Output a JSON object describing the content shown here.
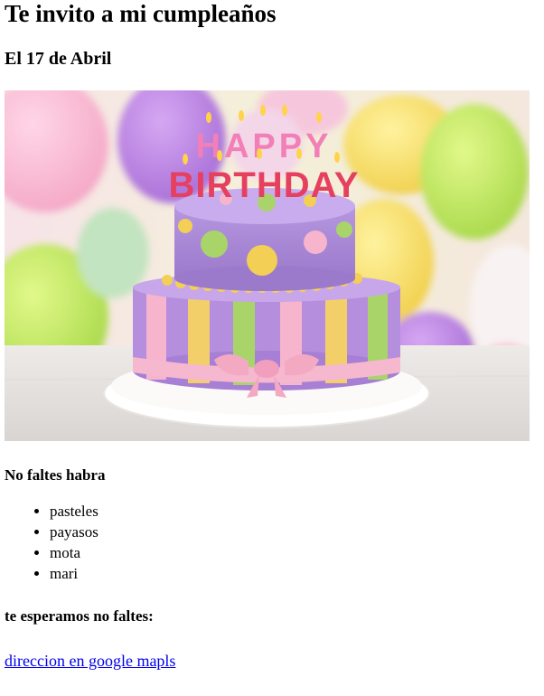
{
  "invitation": {
    "title": "Te invito a mi cumpleaños",
    "date": "El 17 de Abril",
    "image_alt": "Pastel de cumpleaños HAPPY BIRTHDAY",
    "cake_topper_line1": "HAPPY",
    "cake_topper_line2": "BIRTHDAY",
    "list_heading": "No faltes habra",
    "items": [
      "pasteles",
      "payasos",
      "mota",
      "mari"
    ],
    "closing": "te esperamos no faltes:",
    "map_link_text": "direccion en google mapls"
  }
}
